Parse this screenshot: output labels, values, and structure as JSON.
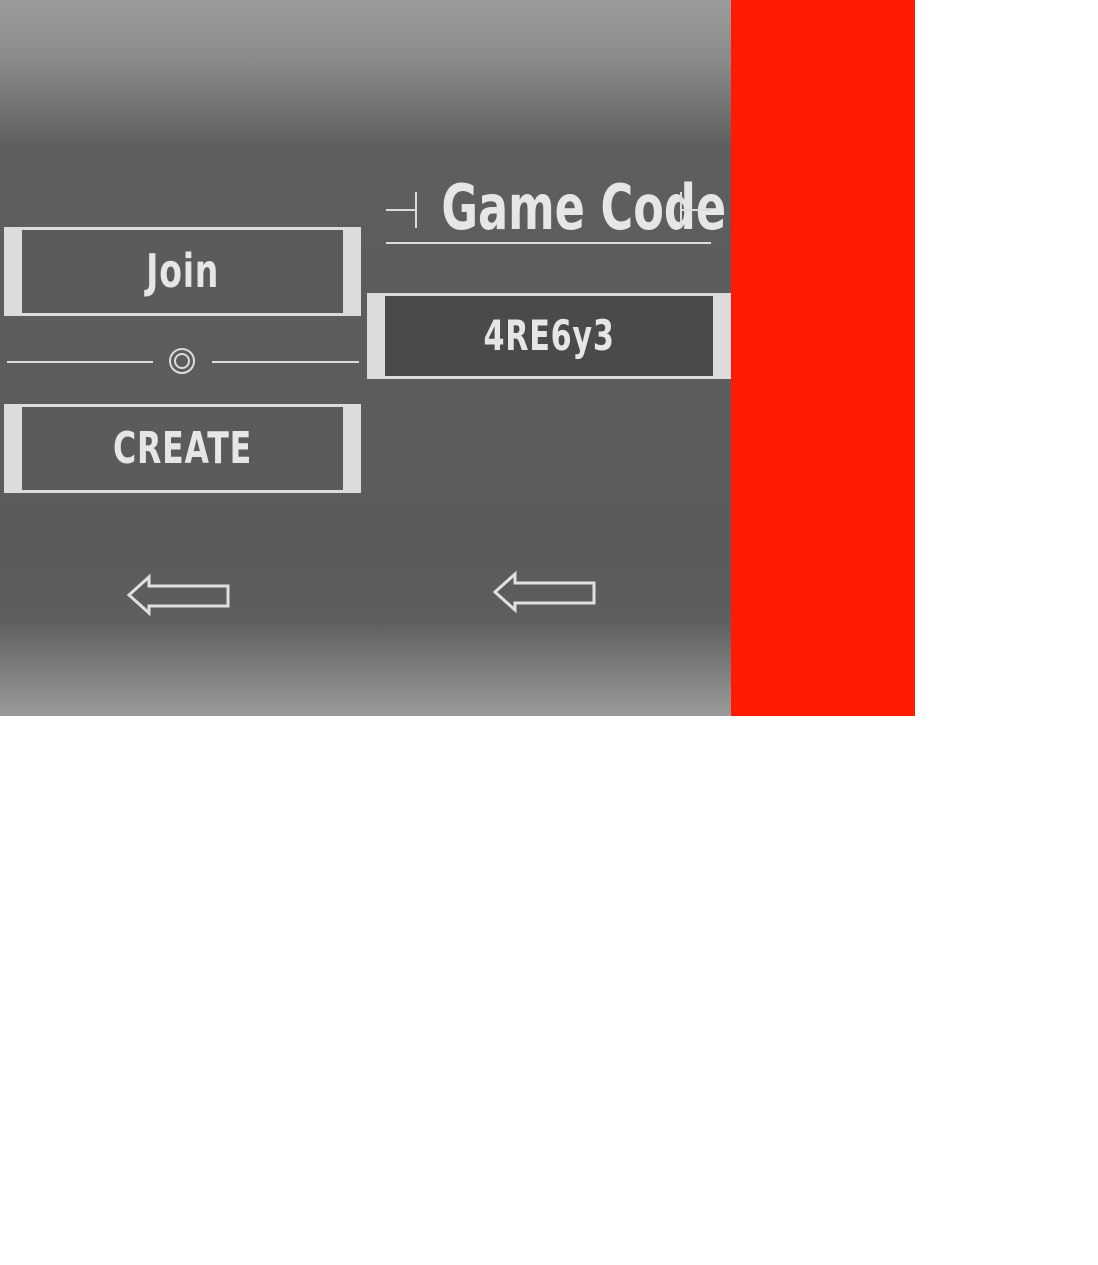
{
  "colors": {
    "panel_gray": "#5b5b5b",
    "code_box_fill": "#4a4a4a",
    "frame_light": "#dcdcdc",
    "text_light": "#e6e6e6",
    "accent_red": "#ff1a00"
  },
  "menu": {
    "join_label": "Join",
    "create_label": "CREATE",
    "divider_icon": "double-circle-icon",
    "back_icon": "left-arrow-icon"
  },
  "join_screen": {
    "title": "Game Code",
    "code_value": "4RE6y3",
    "back_icon": "left-arrow-icon"
  }
}
